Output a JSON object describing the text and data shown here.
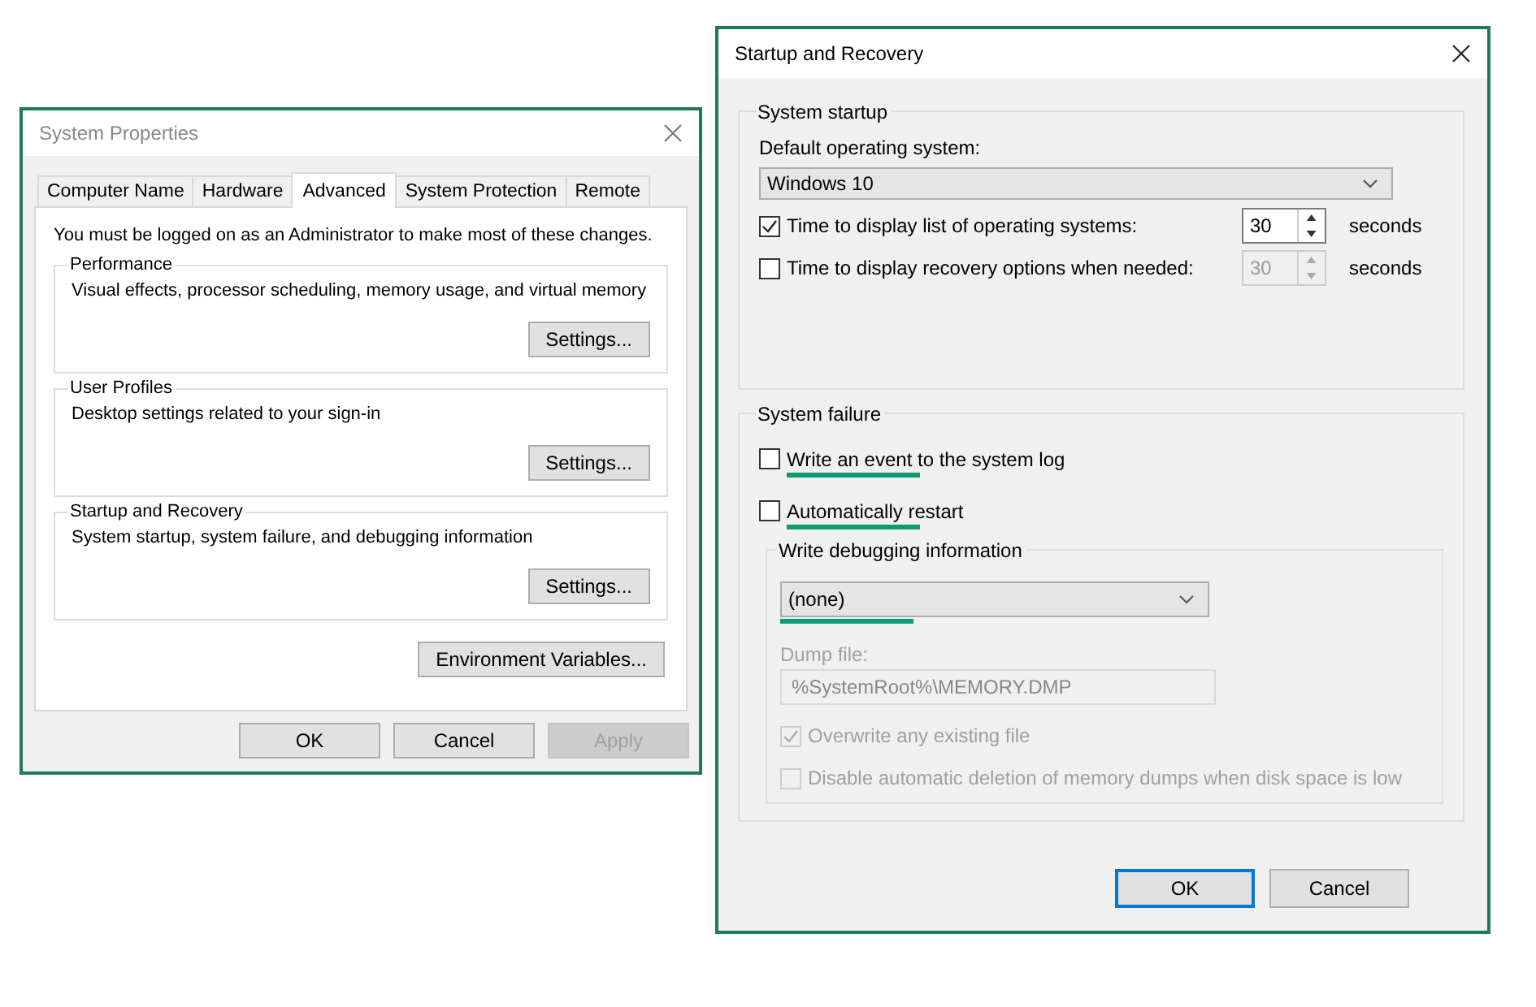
{
  "system_properties": {
    "title": "System Properties",
    "tabs": [
      {
        "label": "Computer Name",
        "selected": false
      },
      {
        "label": "Hardware",
        "selected": false
      },
      {
        "label": "Advanced",
        "selected": true
      },
      {
        "label": "System Protection",
        "selected": false
      },
      {
        "label": "Remote",
        "selected": false
      }
    ],
    "admin_note": "You must be logged on as an Administrator to make most of these changes.",
    "groups": [
      {
        "title": "Performance",
        "description": "Visual effects, processor scheduling, memory usage, and virtual memory",
        "button": "Settings..."
      },
      {
        "title": "User Profiles",
        "description": "Desktop settings related to your sign-in",
        "button": "Settings..."
      },
      {
        "title": "Startup and Recovery",
        "description": "System startup, system failure, and debugging information",
        "button": "Settings..."
      }
    ],
    "environment_button": "Environment Variables...",
    "buttons": [
      {
        "label": "OK",
        "disabled": false
      },
      {
        "label": "Cancel",
        "disabled": false
      },
      {
        "label": "Apply",
        "disabled": true
      }
    ]
  },
  "startup_and_recovery": {
    "title": "Startup and Recovery",
    "system_startup": {
      "title": "System startup",
      "default_os_label": "Default operating system:",
      "default_os": "Windows 10",
      "timers": [
        {
          "label": "Time to display list of operating systems:",
          "checked": true,
          "value": "30",
          "unit": "seconds"
        },
        {
          "label": "Time to display recovery options when needed:",
          "checked": false,
          "value": "30",
          "unit": "seconds"
        }
      ]
    },
    "system_failure": {
      "title": "System failure",
      "options": [
        {
          "label": "Write an event to the system log",
          "checked": false,
          "highlighted": true
        },
        {
          "label": "Automatically restart",
          "checked": false,
          "highlighted": true
        }
      ],
      "debugging": {
        "title": "Write debugging information",
        "dropdown": {
          "value": "(none)",
          "highlighted": true
        },
        "dump_label": "Dump file:",
        "dump_value": "%SystemRoot%\\MEMORY.DMP",
        "options": [
          {
            "label": "Overwrite any existing file",
            "checked": true,
            "disabled": true
          },
          {
            "label": "Disable automatic deletion of memory dumps when disk space is low",
            "checked": false,
            "disabled": true
          }
        ]
      }
    },
    "buttons": [
      {
        "label": "OK",
        "default": true
      },
      {
        "label": "Cancel",
        "default": false
      }
    ]
  }
}
